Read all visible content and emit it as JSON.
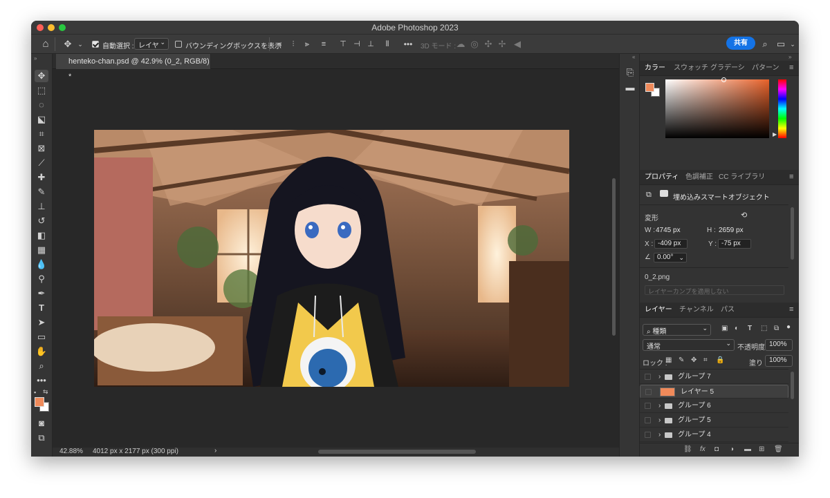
{
  "window": {
    "title": "Adobe Photoshop 2023"
  },
  "options_bar": {
    "auto_select_label": "自動選択 :",
    "auto_select_value": "レイヤー",
    "bounding_box_label": "バウンディングボックスを表示",
    "mode_3d_label": "3D モード :",
    "share_label": "共有"
  },
  "document": {
    "tab_title": "henteko-chan.psd @ 42.9% (0_2, RGB/8) *",
    "zoom": "42.88%",
    "size_info": "4012 px x 2177 px (300 ppi)"
  },
  "color_panel": {
    "tabs": [
      "カラー",
      "スウォッチ",
      "グラデーシ",
      "パターン"
    ],
    "foreground_color": "#ef8a5a",
    "background_color": "#ffffff"
  },
  "properties_panel": {
    "tabs": [
      "プロパティ",
      "色調補正",
      "CC ライブラリ"
    ],
    "object_type": "埋め込みスマートオブジェクト",
    "transform_label": "変形",
    "w_label": "W :",
    "w_value": "4745 px",
    "h_label": "H :",
    "h_value": "2659 px",
    "x_label": "X :",
    "x_value": "-409 px",
    "y_label": "Y :",
    "y_value": "-75 px",
    "angle_value": "0.00°",
    "file_name": "0_2.png",
    "layer_comp": "レイヤーカンプを適用しない"
  },
  "layers_panel": {
    "tabs": [
      "レイヤー",
      "チャンネル",
      "パス"
    ],
    "filter_label": "種類",
    "blend_mode": "通常",
    "opacity_label": "不透明度 :",
    "opacity_value": "100%",
    "lock_label": "ロック :",
    "fill_label": "塗り :",
    "fill_value": "100%",
    "layers": [
      {
        "name": "グループ 7",
        "kind": "group"
      },
      {
        "name": "レイヤー 5",
        "kind": "fill",
        "color": "#f08a5a"
      },
      {
        "name": "グループ 6",
        "kind": "group"
      },
      {
        "name": "グループ 5",
        "kind": "group"
      },
      {
        "name": "グループ 4",
        "kind": "group"
      }
    ]
  }
}
